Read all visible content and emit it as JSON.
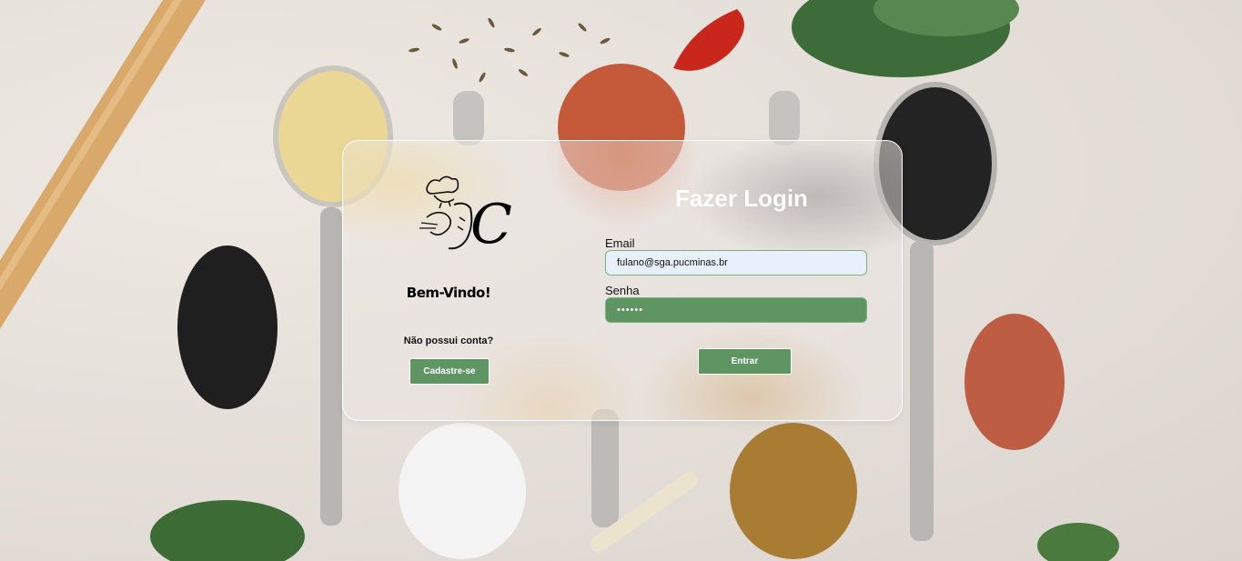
{
  "login_card": {
    "welcome_text": "Bem-Vindo!",
    "no_account_text": "Não possui conta?",
    "register_button_label": "Cadastre-se",
    "title": "Fazer Login",
    "email_label": "Email",
    "email_value": "fulano@sga.pucminas.br",
    "password_label": "Senha",
    "password_value": "••••••",
    "login_button_label": "Entrar"
  },
  "logo": {
    "icon": "chef-logo-icon",
    "letter": "C"
  },
  "colors": {
    "accent_green": "#5e9563",
    "email_field_bg": "#e8f0fe",
    "title_color": "#ffffff"
  },
  "background": {
    "icon": "spices-background-image"
  }
}
